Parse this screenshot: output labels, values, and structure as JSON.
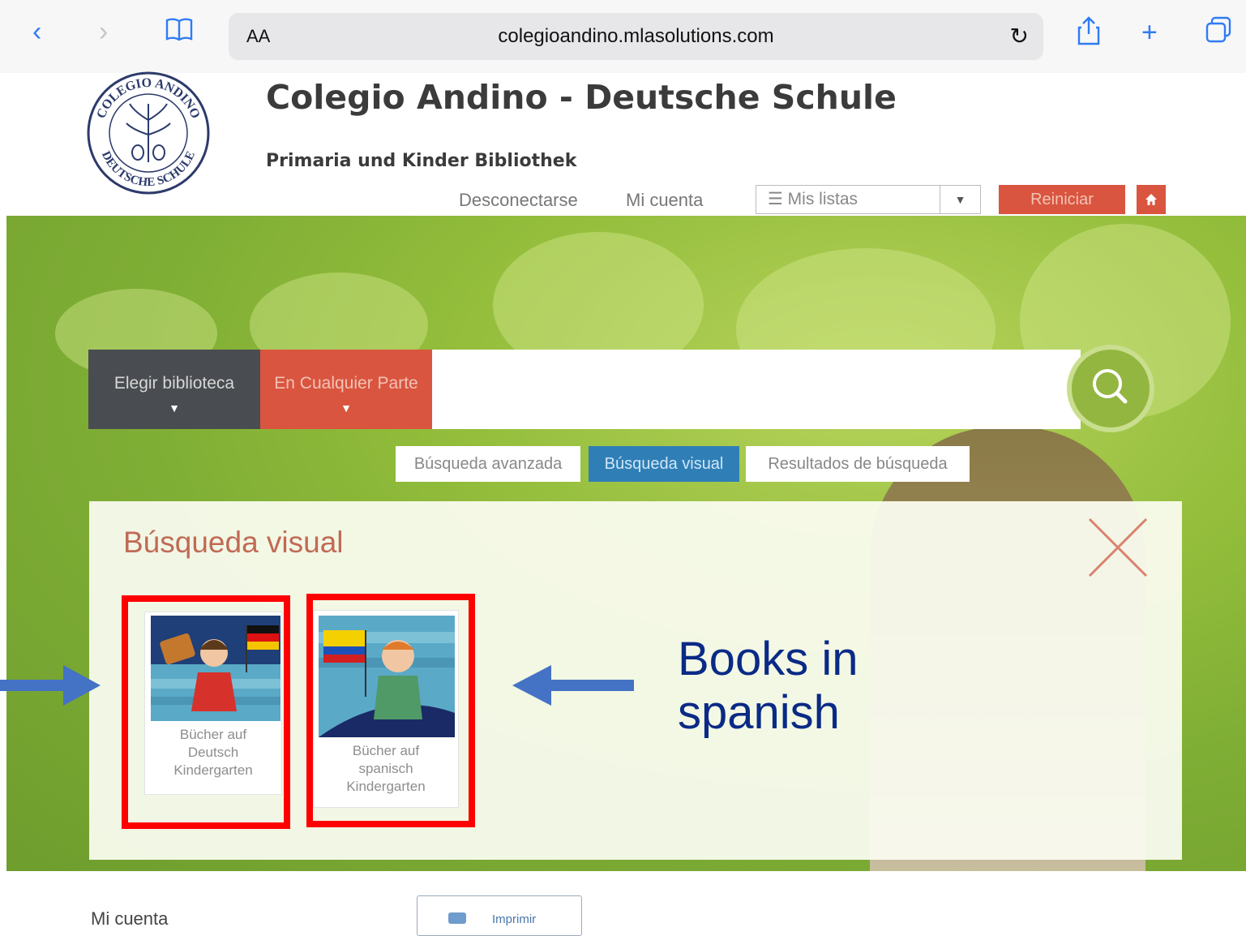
{
  "browser": {
    "text_size_label": "AA",
    "url": "colegioandino.mlasolutions.com"
  },
  "header": {
    "title": "Colegio Andino - Deutsche Schule",
    "subtitle": "Primaria und Kinder Bibliothek",
    "logo_text_top": "COLEGIO ANDINO",
    "logo_text_bottom": "DEUTSCHE SCHULE"
  },
  "topnav": {
    "logout": "Desconectarse",
    "account": "Mi cuenta",
    "lists_label": "Mis listas",
    "reset": "Reiniciar"
  },
  "search": {
    "library_select": "Elegir biblioteca",
    "location_select": "En Cualquier Parte",
    "query": ""
  },
  "tabs": [
    {
      "label": "Búsqueda avanzada",
      "active": false
    },
    {
      "label": "Búsqueda visual",
      "active": true
    },
    {
      "label": "Resultados de búsqueda",
      "active": false
    }
  ],
  "visual_search": {
    "title": "Búsqueda visual",
    "cards": [
      {
        "caption": "Bücher auf\nDeutsch\nKindergarten",
        "flag": "germany"
      },
      {
        "caption": "Bücher auf\nspanisch\nKindergarten",
        "flag": "colombia"
      }
    ]
  },
  "annotation": {
    "text": "Books in\nspanish",
    "arrow_color": "#4472c4",
    "highlight_color": "#ff0000"
  },
  "footer": {
    "account": "Mi cuenta",
    "print": "Imprimir"
  },
  "colors": {
    "accent_red": "#d9553f",
    "dark_select": "#494c50",
    "active_tab": "#2f7fb6",
    "search_green": "#93b641"
  }
}
